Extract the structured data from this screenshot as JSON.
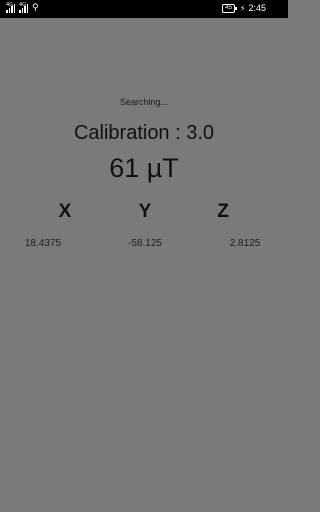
{
  "status_bar": {
    "signal1_label": "4G",
    "signal2_label": "4G",
    "usb_icon": "usb-icon",
    "battery_level": "45",
    "charge_icon": "charging-icon",
    "time": "2:45"
  },
  "main": {
    "status_text": "Searching...",
    "calibration_text": "Calibration : 3.0",
    "field_strength": "61 µT",
    "axes": [
      {
        "label": "X",
        "value": "18.4375"
      },
      {
        "label": "Y",
        "value": "-58.125"
      },
      {
        "label": "Z",
        "value": "2.8125"
      }
    ]
  },
  "colors": {
    "background": "#7a7a7a",
    "status_bar": "#000000",
    "text": "#111111"
  }
}
